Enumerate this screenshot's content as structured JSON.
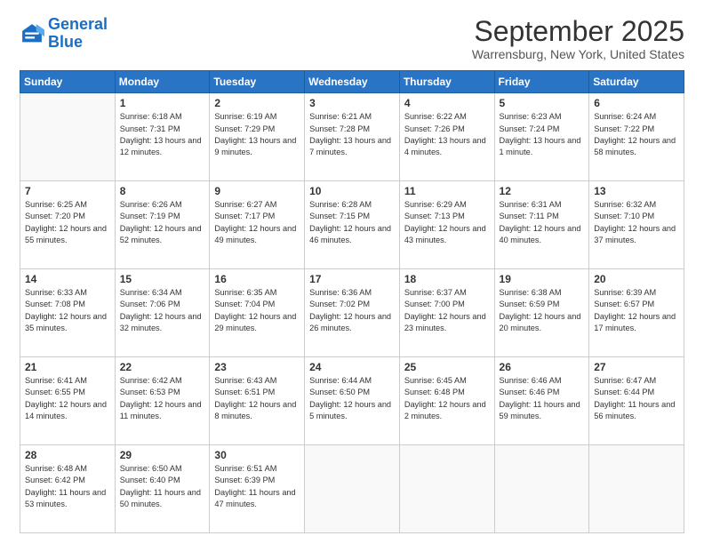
{
  "logo": {
    "line1": "General",
    "line2": "Blue"
  },
  "title": "September 2025",
  "location": "Warrensburg, New York, United States",
  "days_of_week": [
    "Sunday",
    "Monday",
    "Tuesday",
    "Wednesday",
    "Thursday",
    "Friday",
    "Saturday"
  ],
  "weeks": [
    [
      {
        "day": "",
        "sunrise": "",
        "sunset": "",
        "daylight": ""
      },
      {
        "day": "1",
        "sunrise": "Sunrise: 6:18 AM",
        "sunset": "Sunset: 7:31 PM",
        "daylight": "Daylight: 13 hours and 12 minutes."
      },
      {
        "day": "2",
        "sunrise": "Sunrise: 6:19 AM",
        "sunset": "Sunset: 7:29 PM",
        "daylight": "Daylight: 13 hours and 9 minutes."
      },
      {
        "day": "3",
        "sunrise": "Sunrise: 6:21 AM",
        "sunset": "Sunset: 7:28 PM",
        "daylight": "Daylight: 13 hours and 7 minutes."
      },
      {
        "day": "4",
        "sunrise": "Sunrise: 6:22 AM",
        "sunset": "Sunset: 7:26 PM",
        "daylight": "Daylight: 13 hours and 4 minutes."
      },
      {
        "day": "5",
        "sunrise": "Sunrise: 6:23 AM",
        "sunset": "Sunset: 7:24 PM",
        "daylight": "Daylight: 13 hours and 1 minute."
      },
      {
        "day": "6",
        "sunrise": "Sunrise: 6:24 AM",
        "sunset": "Sunset: 7:22 PM",
        "daylight": "Daylight: 12 hours and 58 minutes."
      }
    ],
    [
      {
        "day": "7",
        "sunrise": "Sunrise: 6:25 AM",
        "sunset": "Sunset: 7:20 PM",
        "daylight": "Daylight: 12 hours and 55 minutes."
      },
      {
        "day": "8",
        "sunrise": "Sunrise: 6:26 AM",
        "sunset": "Sunset: 7:19 PM",
        "daylight": "Daylight: 12 hours and 52 minutes."
      },
      {
        "day": "9",
        "sunrise": "Sunrise: 6:27 AM",
        "sunset": "Sunset: 7:17 PM",
        "daylight": "Daylight: 12 hours and 49 minutes."
      },
      {
        "day": "10",
        "sunrise": "Sunrise: 6:28 AM",
        "sunset": "Sunset: 7:15 PM",
        "daylight": "Daylight: 12 hours and 46 minutes."
      },
      {
        "day": "11",
        "sunrise": "Sunrise: 6:29 AM",
        "sunset": "Sunset: 7:13 PM",
        "daylight": "Daylight: 12 hours and 43 minutes."
      },
      {
        "day": "12",
        "sunrise": "Sunrise: 6:31 AM",
        "sunset": "Sunset: 7:11 PM",
        "daylight": "Daylight: 12 hours and 40 minutes."
      },
      {
        "day": "13",
        "sunrise": "Sunrise: 6:32 AM",
        "sunset": "Sunset: 7:10 PM",
        "daylight": "Daylight: 12 hours and 37 minutes."
      }
    ],
    [
      {
        "day": "14",
        "sunrise": "Sunrise: 6:33 AM",
        "sunset": "Sunset: 7:08 PM",
        "daylight": "Daylight: 12 hours and 35 minutes."
      },
      {
        "day": "15",
        "sunrise": "Sunrise: 6:34 AM",
        "sunset": "Sunset: 7:06 PM",
        "daylight": "Daylight: 12 hours and 32 minutes."
      },
      {
        "day": "16",
        "sunrise": "Sunrise: 6:35 AM",
        "sunset": "Sunset: 7:04 PM",
        "daylight": "Daylight: 12 hours and 29 minutes."
      },
      {
        "day": "17",
        "sunrise": "Sunrise: 6:36 AM",
        "sunset": "Sunset: 7:02 PM",
        "daylight": "Daylight: 12 hours and 26 minutes."
      },
      {
        "day": "18",
        "sunrise": "Sunrise: 6:37 AM",
        "sunset": "Sunset: 7:00 PM",
        "daylight": "Daylight: 12 hours and 23 minutes."
      },
      {
        "day": "19",
        "sunrise": "Sunrise: 6:38 AM",
        "sunset": "Sunset: 6:59 PM",
        "daylight": "Daylight: 12 hours and 20 minutes."
      },
      {
        "day": "20",
        "sunrise": "Sunrise: 6:39 AM",
        "sunset": "Sunset: 6:57 PM",
        "daylight": "Daylight: 12 hours and 17 minutes."
      }
    ],
    [
      {
        "day": "21",
        "sunrise": "Sunrise: 6:41 AM",
        "sunset": "Sunset: 6:55 PM",
        "daylight": "Daylight: 12 hours and 14 minutes."
      },
      {
        "day": "22",
        "sunrise": "Sunrise: 6:42 AM",
        "sunset": "Sunset: 6:53 PM",
        "daylight": "Daylight: 12 hours and 11 minutes."
      },
      {
        "day": "23",
        "sunrise": "Sunrise: 6:43 AM",
        "sunset": "Sunset: 6:51 PM",
        "daylight": "Daylight: 12 hours and 8 minutes."
      },
      {
        "day": "24",
        "sunrise": "Sunrise: 6:44 AM",
        "sunset": "Sunset: 6:50 PM",
        "daylight": "Daylight: 12 hours and 5 minutes."
      },
      {
        "day": "25",
        "sunrise": "Sunrise: 6:45 AM",
        "sunset": "Sunset: 6:48 PM",
        "daylight": "Daylight: 12 hours and 2 minutes."
      },
      {
        "day": "26",
        "sunrise": "Sunrise: 6:46 AM",
        "sunset": "Sunset: 6:46 PM",
        "daylight": "Daylight: 11 hours and 59 minutes."
      },
      {
        "day": "27",
        "sunrise": "Sunrise: 6:47 AM",
        "sunset": "Sunset: 6:44 PM",
        "daylight": "Daylight: 11 hours and 56 minutes."
      }
    ],
    [
      {
        "day": "28",
        "sunrise": "Sunrise: 6:48 AM",
        "sunset": "Sunset: 6:42 PM",
        "daylight": "Daylight: 11 hours and 53 minutes."
      },
      {
        "day": "29",
        "sunrise": "Sunrise: 6:50 AM",
        "sunset": "Sunset: 6:40 PM",
        "daylight": "Daylight: 11 hours and 50 minutes."
      },
      {
        "day": "30",
        "sunrise": "Sunrise: 6:51 AM",
        "sunset": "Sunset: 6:39 PM",
        "daylight": "Daylight: 11 hours and 47 minutes."
      },
      {
        "day": "",
        "sunrise": "",
        "sunset": "",
        "daylight": ""
      },
      {
        "day": "",
        "sunrise": "",
        "sunset": "",
        "daylight": ""
      },
      {
        "day": "",
        "sunrise": "",
        "sunset": "",
        "daylight": ""
      },
      {
        "day": "",
        "sunrise": "",
        "sunset": "",
        "daylight": ""
      }
    ]
  ]
}
